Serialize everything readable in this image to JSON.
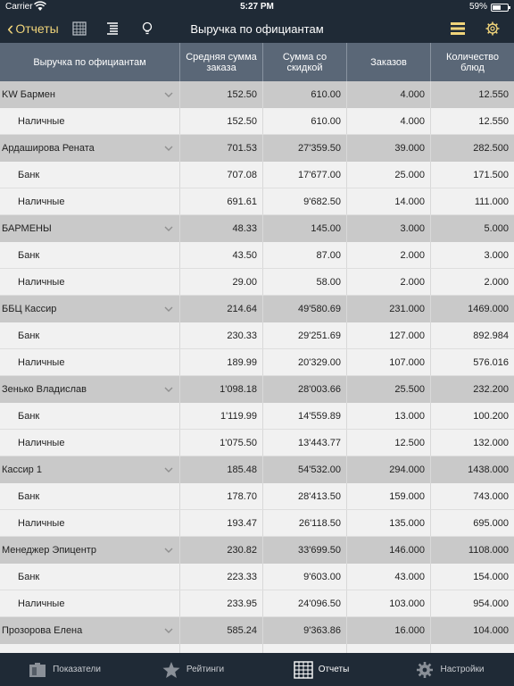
{
  "status": {
    "carrier": "Carrier",
    "time": "5:27 PM",
    "battery": "59%",
    "battery_level": 0.59
  },
  "nav": {
    "back_label": "Отчеты",
    "title": "Выручка по официантам"
  },
  "table": {
    "headers": [
      "Выручка по официантам",
      "Средняя сумма заказа",
      "Сумма со скидкой",
      "Заказов",
      "Количество блюд"
    ],
    "rows": [
      {
        "type": "group",
        "cells": [
          "KW Бармен",
          "152.50",
          "610.00",
          "4.000",
          "12.550"
        ]
      },
      {
        "type": "sub",
        "cells": [
          "Наличные",
          "152.50",
          "610.00",
          "4.000",
          "12.550"
        ]
      },
      {
        "type": "group",
        "cells": [
          "Ардаширова Рената",
          "701.53",
          "27'359.50",
          "39.000",
          "282.500"
        ]
      },
      {
        "type": "sub",
        "cells": [
          "Банк",
          "707.08",
          "17'677.00",
          "25.000",
          "171.500"
        ]
      },
      {
        "type": "sub",
        "cells": [
          "Наличные",
          "691.61",
          "9'682.50",
          "14.000",
          "111.000"
        ]
      },
      {
        "type": "group",
        "cells": [
          "БАРМЕНЫ",
          "48.33",
          "145.00",
          "3.000",
          "5.000"
        ]
      },
      {
        "type": "sub",
        "cells": [
          "Банк",
          "43.50",
          "87.00",
          "2.000",
          "3.000"
        ]
      },
      {
        "type": "sub",
        "cells": [
          "Наличные",
          "29.00",
          "58.00",
          "2.000",
          "2.000"
        ]
      },
      {
        "type": "group",
        "cells": [
          "ББЦ Кассир",
          "214.64",
          "49'580.69",
          "231.000",
          "1469.000"
        ]
      },
      {
        "type": "sub",
        "cells": [
          "Банк",
          "230.33",
          "29'251.69",
          "127.000",
          "892.984"
        ]
      },
      {
        "type": "sub",
        "cells": [
          "Наличные",
          "189.99",
          "20'329.00",
          "107.000",
          "576.016"
        ]
      },
      {
        "type": "group",
        "cells": [
          "Зенько Владислав",
          "1'098.18",
          "28'003.66",
          "25.500",
          "232.200"
        ]
      },
      {
        "type": "sub",
        "cells": [
          "Банк",
          "1'119.99",
          "14'559.89",
          "13.000",
          "100.200"
        ]
      },
      {
        "type": "sub",
        "cells": [
          "Наличные",
          "1'075.50",
          "13'443.77",
          "12.500",
          "132.000"
        ]
      },
      {
        "type": "group",
        "cells": [
          "Кассир 1",
          "185.48",
          "54'532.00",
          "294.000",
          "1438.000"
        ]
      },
      {
        "type": "sub",
        "cells": [
          "Банк",
          "178.70",
          "28'413.50",
          "159.000",
          "743.000"
        ]
      },
      {
        "type": "sub",
        "cells": [
          "Наличные",
          "193.47",
          "26'118.50",
          "135.000",
          "695.000"
        ]
      },
      {
        "type": "group",
        "cells": [
          "Менеджер Эпицентр",
          "230.82",
          "33'699.50",
          "146.000",
          "1108.000"
        ]
      },
      {
        "type": "sub",
        "cells": [
          "Банк",
          "223.33",
          "9'603.00",
          "43.000",
          "154.000"
        ]
      },
      {
        "type": "sub",
        "cells": [
          "Наличные",
          "233.95",
          "24'096.50",
          "103.000",
          "954.000"
        ]
      },
      {
        "type": "group",
        "cells": [
          "Прозорова Елена",
          "585.24",
          "9'363.86",
          "16.000",
          "104.000"
        ]
      },
      {
        "type": "sub",
        "cells": [
          "",
          "",
          "",
          "",
          ""
        ]
      }
    ]
  },
  "tabs": [
    {
      "label": "Показатели",
      "icon": "dashboard-icon",
      "active": false
    },
    {
      "label": "Рейтинги",
      "icon": "star-icon",
      "active": false
    },
    {
      "label": "Отчеты",
      "icon": "grid-icon",
      "active": true
    },
    {
      "label": "Настройки",
      "icon": "gear-icon",
      "active": false
    }
  ],
  "colors": {
    "bar": "#1f2a36",
    "header": "#5a6777",
    "accent": "#f0d47a",
    "group_row": "#c9c9c9",
    "sub_row": "#f1f1f1"
  }
}
